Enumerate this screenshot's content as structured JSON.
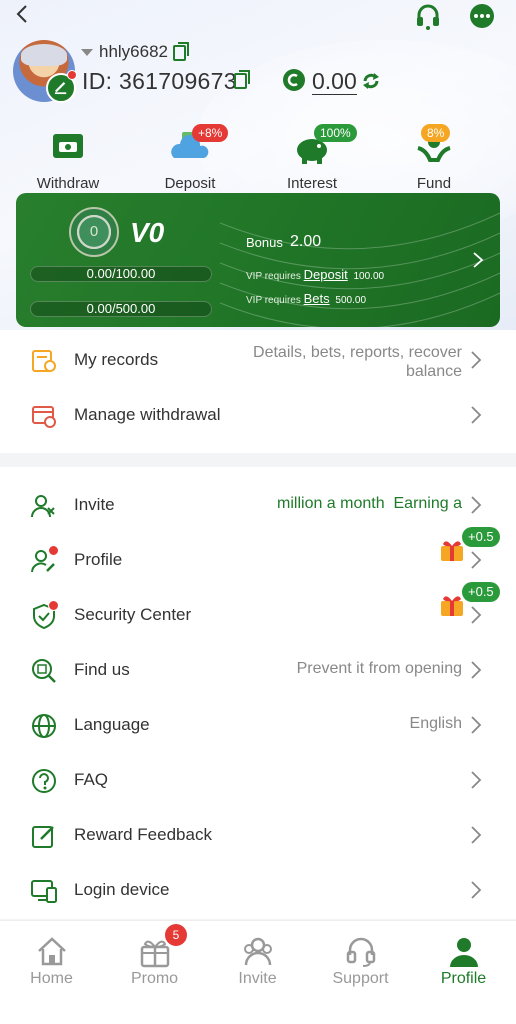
{
  "header": {
    "username": "hhly6682",
    "id_text": "ID: 361709673",
    "balance": "0.00"
  },
  "quick_actions": [
    {
      "label": "Withdraw",
      "icon": "withdraw-icon"
    },
    {
      "label": "Deposit",
      "icon": "deposit-icon",
      "badge": "+8%"
    },
    {
      "label": "Interest",
      "icon": "piggy-bank-icon",
      "badge": "100%"
    },
    {
      "label": "Fund",
      "icon": "fund-icon",
      "badge": "8%"
    }
  ],
  "vip": {
    "medal_level": "0",
    "level": "V0",
    "progress_deposit": "0.00/100.00",
    "progress_bets": "0.00/500.00",
    "bonus_label": "Bonus",
    "bonus_value": "2.00",
    "req_prefix": "VIP requires",
    "req_deposit_label": "Deposit",
    "req_deposit_amount": "100.00",
    "req_bets_label": "Bets",
    "req_bets_amount": "500.00",
    "deposit_progress_fraction": 0,
    "bets_progress_fraction": 0
  },
  "records": [
    {
      "label": "My records",
      "icon": "records-icon",
      "hint_line1": "Details, bets, reports, recover",
      "hint_line2": "balance"
    },
    {
      "label": "Manage withdrawal",
      "icon": "manage-withdrawal-icon"
    }
  ],
  "menu": [
    {
      "label": "Invite",
      "icon": "invite-icon",
      "hint": "million a month  Earning a"
    },
    {
      "label": "Profile",
      "icon": "profile-icon",
      "gift_badge": "+0.5"
    },
    {
      "label": "Security Center",
      "icon": "shield-icon",
      "gift_badge": "+0.5"
    },
    {
      "label": "Find us",
      "icon": "find-icon",
      "hint": "Prevent it from opening"
    },
    {
      "label": "Language",
      "icon": "globe-icon",
      "hint": "English"
    },
    {
      "label": "FAQ",
      "icon": "question-icon"
    },
    {
      "label": "Reward Feedback",
      "icon": "edit-icon"
    },
    {
      "label": "Login device",
      "icon": "device-icon"
    }
  ],
  "tabs": [
    {
      "label": "Home",
      "icon": "home-icon"
    },
    {
      "label": "Promo",
      "icon": "gift-icon",
      "badge": "5"
    },
    {
      "label": "Invite",
      "icon": "people-icon"
    },
    {
      "label": "Support",
      "icon": "headset-icon"
    },
    {
      "label": "Profile",
      "icon": "person-icon",
      "active": true
    }
  ],
  "colors": {
    "brand_green": "#1f7a2a",
    "badge_red": "#e53935",
    "gift_green": "#2b9a3a"
  }
}
